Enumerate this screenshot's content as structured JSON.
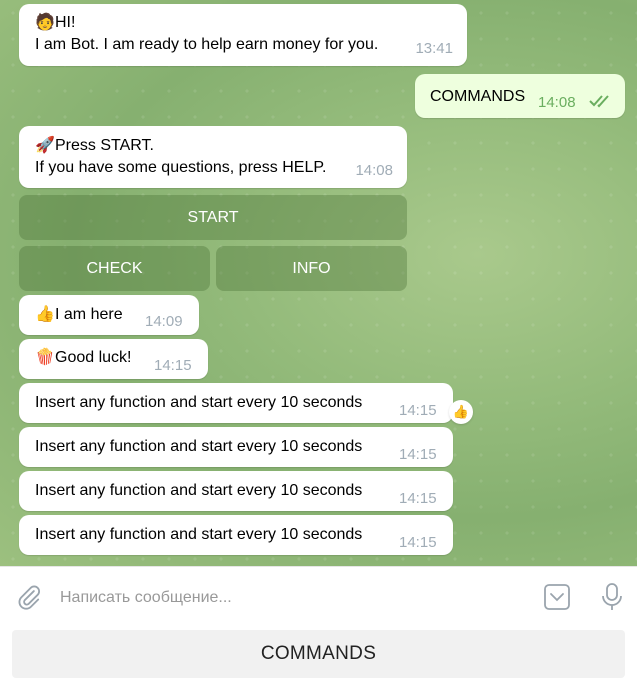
{
  "messages": [
    {
      "emoji": "🧑",
      "lines": [
        "HI!",
        "I am Bot. I am ready to help earn money for you."
      ],
      "time": "13:41"
    },
    {
      "text": "COMMANDS",
      "time": "14:08",
      "outgoing": true
    },
    {
      "emoji": "🚀",
      "lines": [
        "Press START.",
        "If you have some questions, press HELP."
      ],
      "time": "14:08"
    },
    {
      "emoji": "👍",
      "text": "I am here",
      "time": "14:09"
    },
    {
      "emoji": "🍿",
      "text": "Good luck!",
      "time": "14:15"
    },
    {
      "text": "Insert any function and start every 10 seconds",
      "time": "14:15",
      "reaction": "👍"
    },
    {
      "text": "Insert any function and start every 10 seconds",
      "time": "14:15"
    },
    {
      "text": "Insert any function and start every 10 seconds",
      "time": "14:15"
    },
    {
      "text": "Insert any function and start every 10 seconds",
      "time": "14:15"
    }
  ],
  "inline_keyboard": {
    "start": "START",
    "check": "CHECK",
    "info": "INFO"
  },
  "composer": {
    "placeholder": "Написать сообщение...",
    "icons": {
      "attach": "paperclip-icon",
      "keyboard": "chevron-down-icon",
      "voice": "microphone-icon"
    }
  },
  "reply_keyboard": {
    "button": "COMMANDS"
  },
  "colors": {
    "incoming": "#ffffff",
    "outgoing": "#eeffde",
    "read_check": "#6aae5f",
    "timestamp": "#a0acb6"
  }
}
